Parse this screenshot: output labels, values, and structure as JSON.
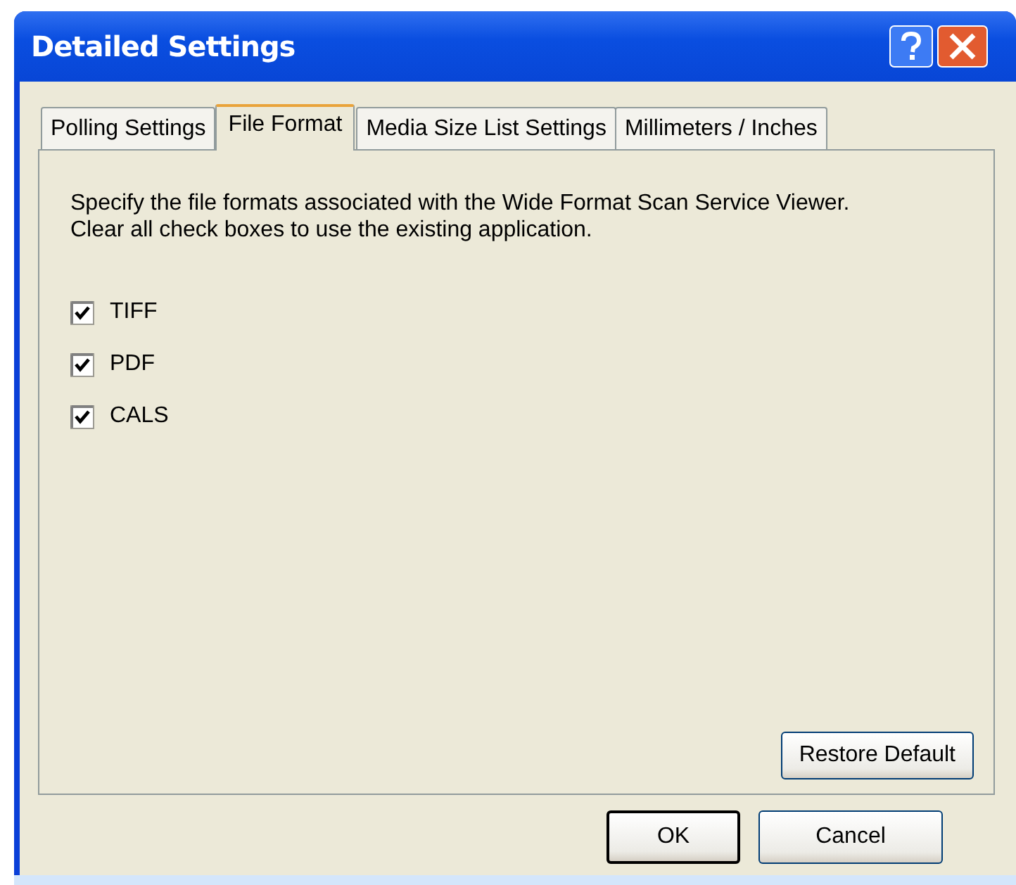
{
  "window": {
    "title": "Detailed Settings"
  },
  "tabs": [
    {
      "label": "Polling Settings",
      "selected": false
    },
    {
      "label": "File Format",
      "selected": true
    },
    {
      "label": "Media Size List Settings",
      "selected": false
    },
    {
      "label": "Millimeters / Inches",
      "selected": false
    }
  ],
  "description": "Specify the file formats associated with the Wide Format Scan Service Viewer.",
  "hint": " Clear all check boxes to use the existing application.",
  "formats": [
    {
      "label": "TIFF",
      "checked": true
    },
    {
      "label": "PDF",
      "checked": true
    },
    {
      "label": "CALS",
      "checked": true
    }
  ],
  "restore_button": "Restore Default",
  "buttons": [
    {
      "label": "OK",
      "default": true
    },
    {
      "label": "Cancel",
      "default": false
    }
  ]
}
